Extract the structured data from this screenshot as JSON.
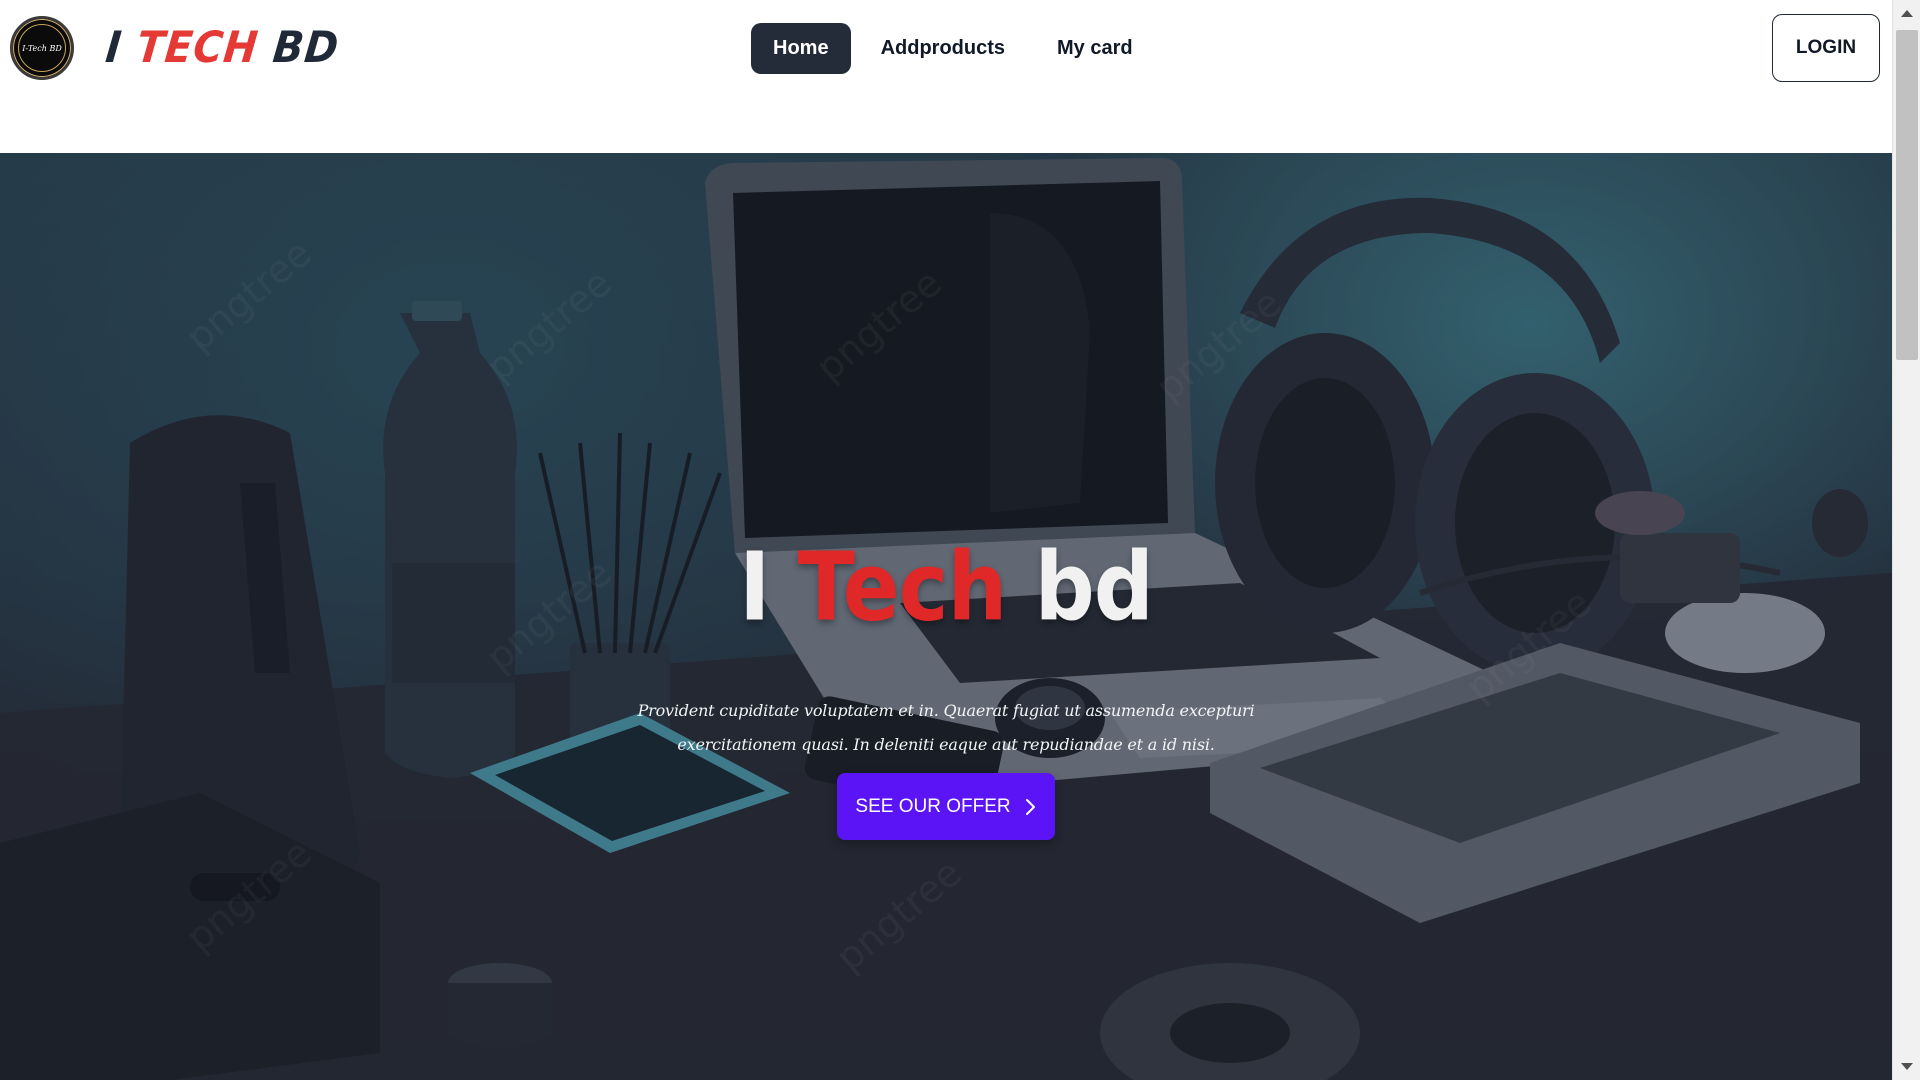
{
  "header": {
    "logo_text": "I-Tech BD",
    "brand": {
      "part1": "I ",
      "part2": "TECH",
      "part3": " BD"
    },
    "nav": [
      {
        "label": "Home",
        "active": true
      },
      {
        "label": "Addproducts",
        "active": false
      },
      {
        "label": "My card",
        "active": false
      }
    ],
    "login_label": "LOGIN"
  },
  "hero": {
    "title": {
      "part1": "I ",
      "part2": "Tech",
      "part3": " bd"
    },
    "description": "Provident cupiditate voluptatem et in. Quaerat fugiat ut assumenda excepturi exercitationem quasi. In deleniti eaque aut repudiandae et a id nisi.",
    "cta_label": "SEE OUR OFFER",
    "cta_icon": "chevron-right-icon"
  },
  "colors": {
    "nav_active_bg": "#242c3a",
    "brand_red": "#e53935",
    "cta_bg": "#5b14f5"
  }
}
